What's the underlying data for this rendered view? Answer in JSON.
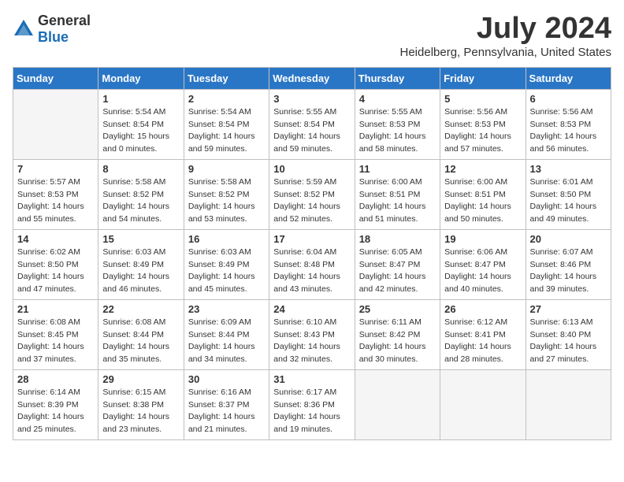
{
  "header": {
    "logo_general": "General",
    "logo_blue": "Blue",
    "month": "July 2024",
    "location": "Heidelberg, Pennsylvania, United States"
  },
  "days_of_week": [
    "Sunday",
    "Monday",
    "Tuesday",
    "Wednesday",
    "Thursday",
    "Friday",
    "Saturday"
  ],
  "weeks": [
    [
      {
        "day": "",
        "info": ""
      },
      {
        "day": "1",
        "info": "Sunrise: 5:54 AM\nSunset: 8:54 PM\nDaylight: 15 hours\nand 0 minutes."
      },
      {
        "day": "2",
        "info": "Sunrise: 5:54 AM\nSunset: 8:54 PM\nDaylight: 14 hours\nand 59 minutes."
      },
      {
        "day": "3",
        "info": "Sunrise: 5:55 AM\nSunset: 8:54 PM\nDaylight: 14 hours\nand 59 minutes."
      },
      {
        "day": "4",
        "info": "Sunrise: 5:55 AM\nSunset: 8:53 PM\nDaylight: 14 hours\nand 58 minutes."
      },
      {
        "day": "5",
        "info": "Sunrise: 5:56 AM\nSunset: 8:53 PM\nDaylight: 14 hours\nand 57 minutes."
      },
      {
        "day": "6",
        "info": "Sunrise: 5:56 AM\nSunset: 8:53 PM\nDaylight: 14 hours\nand 56 minutes."
      }
    ],
    [
      {
        "day": "7",
        "info": "Sunrise: 5:57 AM\nSunset: 8:53 PM\nDaylight: 14 hours\nand 55 minutes."
      },
      {
        "day": "8",
        "info": "Sunrise: 5:58 AM\nSunset: 8:52 PM\nDaylight: 14 hours\nand 54 minutes."
      },
      {
        "day": "9",
        "info": "Sunrise: 5:58 AM\nSunset: 8:52 PM\nDaylight: 14 hours\nand 53 minutes."
      },
      {
        "day": "10",
        "info": "Sunrise: 5:59 AM\nSunset: 8:52 PM\nDaylight: 14 hours\nand 52 minutes."
      },
      {
        "day": "11",
        "info": "Sunrise: 6:00 AM\nSunset: 8:51 PM\nDaylight: 14 hours\nand 51 minutes."
      },
      {
        "day": "12",
        "info": "Sunrise: 6:00 AM\nSunset: 8:51 PM\nDaylight: 14 hours\nand 50 minutes."
      },
      {
        "day": "13",
        "info": "Sunrise: 6:01 AM\nSunset: 8:50 PM\nDaylight: 14 hours\nand 49 minutes."
      }
    ],
    [
      {
        "day": "14",
        "info": "Sunrise: 6:02 AM\nSunset: 8:50 PM\nDaylight: 14 hours\nand 47 minutes."
      },
      {
        "day": "15",
        "info": "Sunrise: 6:03 AM\nSunset: 8:49 PM\nDaylight: 14 hours\nand 46 minutes."
      },
      {
        "day": "16",
        "info": "Sunrise: 6:03 AM\nSunset: 8:49 PM\nDaylight: 14 hours\nand 45 minutes."
      },
      {
        "day": "17",
        "info": "Sunrise: 6:04 AM\nSunset: 8:48 PM\nDaylight: 14 hours\nand 43 minutes."
      },
      {
        "day": "18",
        "info": "Sunrise: 6:05 AM\nSunset: 8:47 PM\nDaylight: 14 hours\nand 42 minutes."
      },
      {
        "day": "19",
        "info": "Sunrise: 6:06 AM\nSunset: 8:47 PM\nDaylight: 14 hours\nand 40 minutes."
      },
      {
        "day": "20",
        "info": "Sunrise: 6:07 AM\nSunset: 8:46 PM\nDaylight: 14 hours\nand 39 minutes."
      }
    ],
    [
      {
        "day": "21",
        "info": "Sunrise: 6:08 AM\nSunset: 8:45 PM\nDaylight: 14 hours\nand 37 minutes."
      },
      {
        "day": "22",
        "info": "Sunrise: 6:08 AM\nSunset: 8:44 PM\nDaylight: 14 hours\nand 35 minutes."
      },
      {
        "day": "23",
        "info": "Sunrise: 6:09 AM\nSunset: 8:44 PM\nDaylight: 14 hours\nand 34 minutes."
      },
      {
        "day": "24",
        "info": "Sunrise: 6:10 AM\nSunset: 8:43 PM\nDaylight: 14 hours\nand 32 minutes."
      },
      {
        "day": "25",
        "info": "Sunrise: 6:11 AM\nSunset: 8:42 PM\nDaylight: 14 hours\nand 30 minutes."
      },
      {
        "day": "26",
        "info": "Sunrise: 6:12 AM\nSunset: 8:41 PM\nDaylight: 14 hours\nand 28 minutes."
      },
      {
        "day": "27",
        "info": "Sunrise: 6:13 AM\nSunset: 8:40 PM\nDaylight: 14 hours\nand 27 minutes."
      }
    ],
    [
      {
        "day": "28",
        "info": "Sunrise: 6:14 AM\nSunset: 8:39 PM\nDaylight: 14 hours\nand 25 minutes."
      },
      {
        "day": "29",
        "info": "Sunrise: 6:15 AM\nSunset: 8:38 PM\nDaylight: 14 hours\nand 23 minutes."
      },
      {
        "day": "30",
        "info": "Sunrise: 6:16 AM\nSunset: 8:37 PM\nDaylight: 14 hours\nand 21 minutes."
      },
      {
        "day": "31",
        "info": "Sunrise: 6:17 AM\nSunset: 8:36 PM\nDaylight: 14 hours\nand 19 minutes."
      },
      {
        "day": "",
        "info": ""
      },
      {
        "day": "",
        "info": ""
      },
      {
        "day": "",
        "info": ""
      }
    ]
  ]
}
